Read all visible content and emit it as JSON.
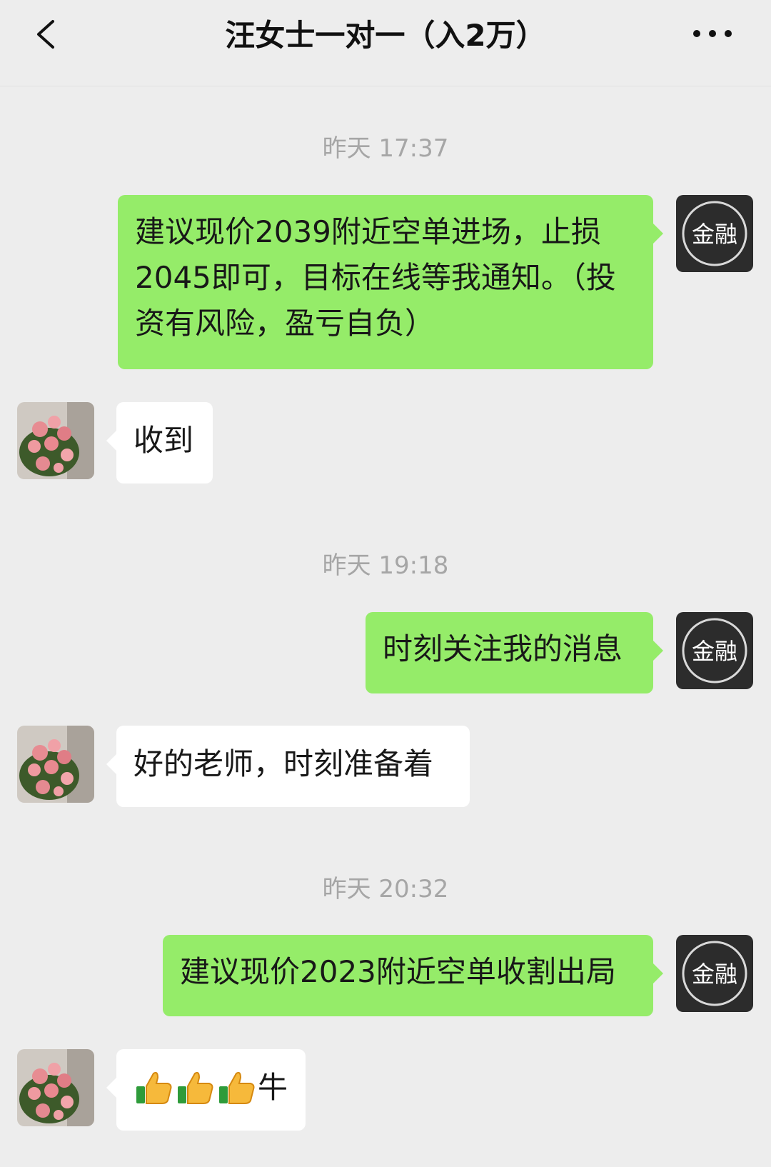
{
  "header": {
    "title": "汪女士一对一（入2万）"
  },
  "colors": {
    "outgoing_bubble": "#95ec69",
    "incoming_bubble": "#ffffff",
    "background": "#ededed",
    "timestamp": "#a6a6a6"
  },
  "chat": {
    "timestamps": [
      "昨天 17:37",
      "昨天 19:18",
      "昨天 20:32"
    ],
    "sender_avatar_text": "金融",
    "messages": [
      {
        "from": "me",
        "text": "建议现价2039附近空单进场，止损2045即可，目标在线等我通知。（投资有风险，盈亏自负）"
      },
      {
        "from": "other",
        "text": "收到"
      },
      {
        "from": "me",
        "text": "时刻关注我的消息"
      },
      {
        "from": "other",
        "text": "好的老师，时刻准备着"
      },
      {
        "from": "me",
        "text": "建议现价2023附近空单收割出局"
      },
      {
        "from": "other",
        "text": "牛",
        "emoji": [
          "thumbs-up",
          "thumbs-up",
          "thumbs-up"
        ]
      }
    ]
  }
}
